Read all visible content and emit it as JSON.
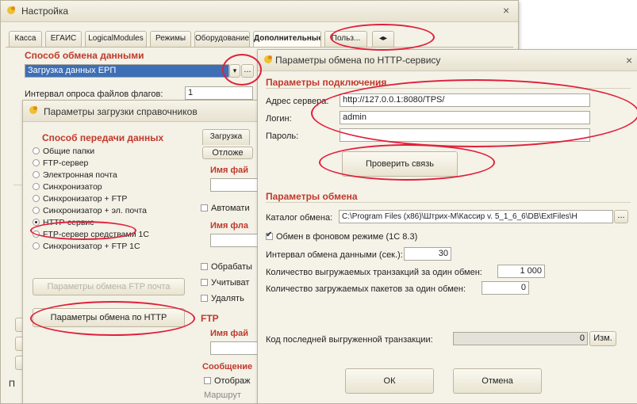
{
  "main_window": {
    "title": "Настройка",
    "close_label": "×",
    "tabs": [
      "Касса",
      "ЕГАИС",
      "LogicalModules",
      "Режимы",
      "Оборудование",
      "Дополнительные",
      "Польз..."
    ],
    "tab_nav_prev": "◂",
    "tab_nav_next": "▸",
    "exchange_method_title": "Способ обмена данными",
    "exchange_method_value": "Загрузка данных ЕРП",
    "dropdown_arrow": "▾",
    "dots_label": "...",
    "flag_poll_label": "Интервал опроса файлов флагов:",
    "flag_poll_value": "1",
    "bottom_letter": "П"
  },
  "load_dialog": {
    "title": "Параметры загрузки справочников",
    "transfer_title": "Способ передачи данных",
    "options": [
      "Общие папки",
      "FTP-сервер",
      "Электронная почта",
      "Синхронизатор",
      "Синхронизатор + FTP",
      "Синхронизатор + эл. почта",
      "HTTP-сервис",
      "FTP-сервер средствами 1С",
      "Синхронизатор + FTP 1С"
    ],
    "selected_option": "HTTP-сервис",
    "ftp_mail_button": "Параметры обмена FTP почта",
    "http_button": "Параметры обмена по HTTP",
    "right_tab": "Загрузка",
    "right_subtab": "Отложе",
    "file_name_label": "Имя фай",
    "auto_label": "Автомати",
    "file_name2_label": "Имя фла",
    "process_label": "Обрабаты",
    "consider_label": "Учитыват",
    "delete_label": "Удалять",
    "ftp_label": "FTP",
    "ftp_file_label": "Имя фай",
    "message_label": "Сообщение",
    "display_label": "Отображ",
    "more_label": "Маршрут"
  },
  "http_dialog": {
    "title": "Параметры обмена по HTTP-сервису",
    "close_label": "×",
    "connection_title": "Параметры подключения",
    "server_label": "Адрес сервера:",
    "server_value": "http://127.0.0.1:8080/TPS/",
    "login_label": "Логин:",
    "login_value": "admin",
    "password_label": "Пароль:",
    "password_value": "",
    "check_button": "Проверить связь",
    "exchange_title": "Параметры обмена",
    "catalog_label": "Каталог обмена:",
    "catalog_value": "C:\\Program Files (x86)\\Штрих-М\\Кассир v. 5_1_6_6\\DB\\ExtFiles\\H",
    "catalog_dots": "...",
    "background_label": "Обмен в фоновом режиме (1С 8.3)",
    "background_checked": true,
    "interval_label": "Интервал обмена данными (сек.):",
    "interval_value": "30",
    "transactions_label": "Количество выгружаемых транзакций за один обмен:",
    "transactions_value": "1 000",
    "packages_label": "Количество загружаемых пакетов за один обмен:",
    "packages_value": "0",
    "last_tx_label": "Код последней выгруженной транзакции:",
    "last_tx_value": "0",
    "change_button": "Изм.",
    "ok_button": "ОК",
    "cancel_button": "Отмена"
  },
  "colors": {
    "accent_red": "#c0392b",
    "annotation_red": "#e0203a",
    "selection_blue": "#3d6fb6"
  }
}
